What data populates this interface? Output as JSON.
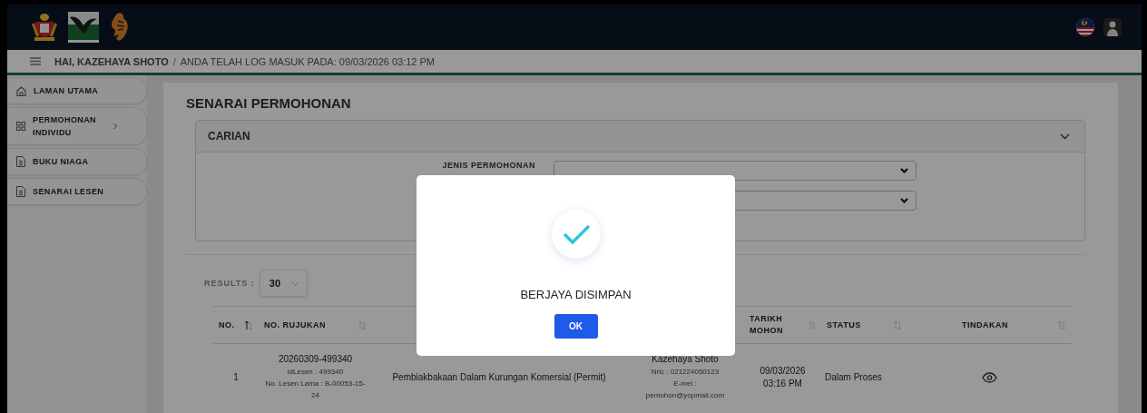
{
  "header": {
    "greeting": "HAI, KAZEHAYA SHOTO",
    "separator": "/",
    "login_info": "ANDA TELAH LOG MASUK PADA: 09/03/2026 03:12 PM"
  },
  "sidebar": {
    "items": [
      {
        "label": "LAMAN UTAMA",
        "kind": "home"
      },
      {
        "label": "PERMOHONAN INDIVIDU",
        "kind": "group",
        "expanded": false
      },
      {
        "label": "BUKU NIAGA",
        "kind": "page"
      },
      {
        "label": "SENARAI LESEN",
        "kind": "page"
      }
    ]
  },
  "page_title": "SENARAI PERMOHONAN",
  "search_panel": {
    "title": "CARIAN",
    "expanded": true,
    "fields": [
      {
        "kind": "labelled",
        "label": "JENIS PERMOHONAN"
      },
      {
        "kind": "plain"
      }
    ]
  },
  "results": {
    "label": "RESULTS :",
    "value": "30"
  },
  "table": {
    "columns": [
      {
        "kind": "header",
        "label": "NO.",
        "sorted": true
      },
      {
        "kind": "header",
        "label": "NO. RUJUKAN",
        "sorted": false
      },
      {
        "kind": "hidden"
      },
      {
        "kind": "hidden"
      },
      {
        "kind": "header",
        "label": "TARIKH MOHON",
        "sorted": false
      },
      {
        "kind": "header",
        "label": "STATUS",
        "sorted": false
      },
      {
        "kind": "header",
        "label": "TINDAKAN",
        "sorted": false
      }
    ],
    "rows": [
      {
        "no": "1",
        "reference": {
          "main": "20260309-499340",
          "details": [
            "idLesen : 499340",
            "No. Lesen Lama : B-00053-15-24"
          ]
        },
        "type": "Pembiakbakaan Dalam Kurungan Komersial (Permit)",
        "applicant": {
          "main": "Kazehaya Shoto",
          "details": [
            "Nric : 021224050123",
            "E-mel : pemohon@yopmail.com"
          ]
        },
        "date": "09/03/2026 03:16 PM",
        "status": "Dalam Proses"
      }
    ]
  },
  "dialog": {
    "message": "BERJAYA DISIMPAN",
    "button": "OK"
  }
}
